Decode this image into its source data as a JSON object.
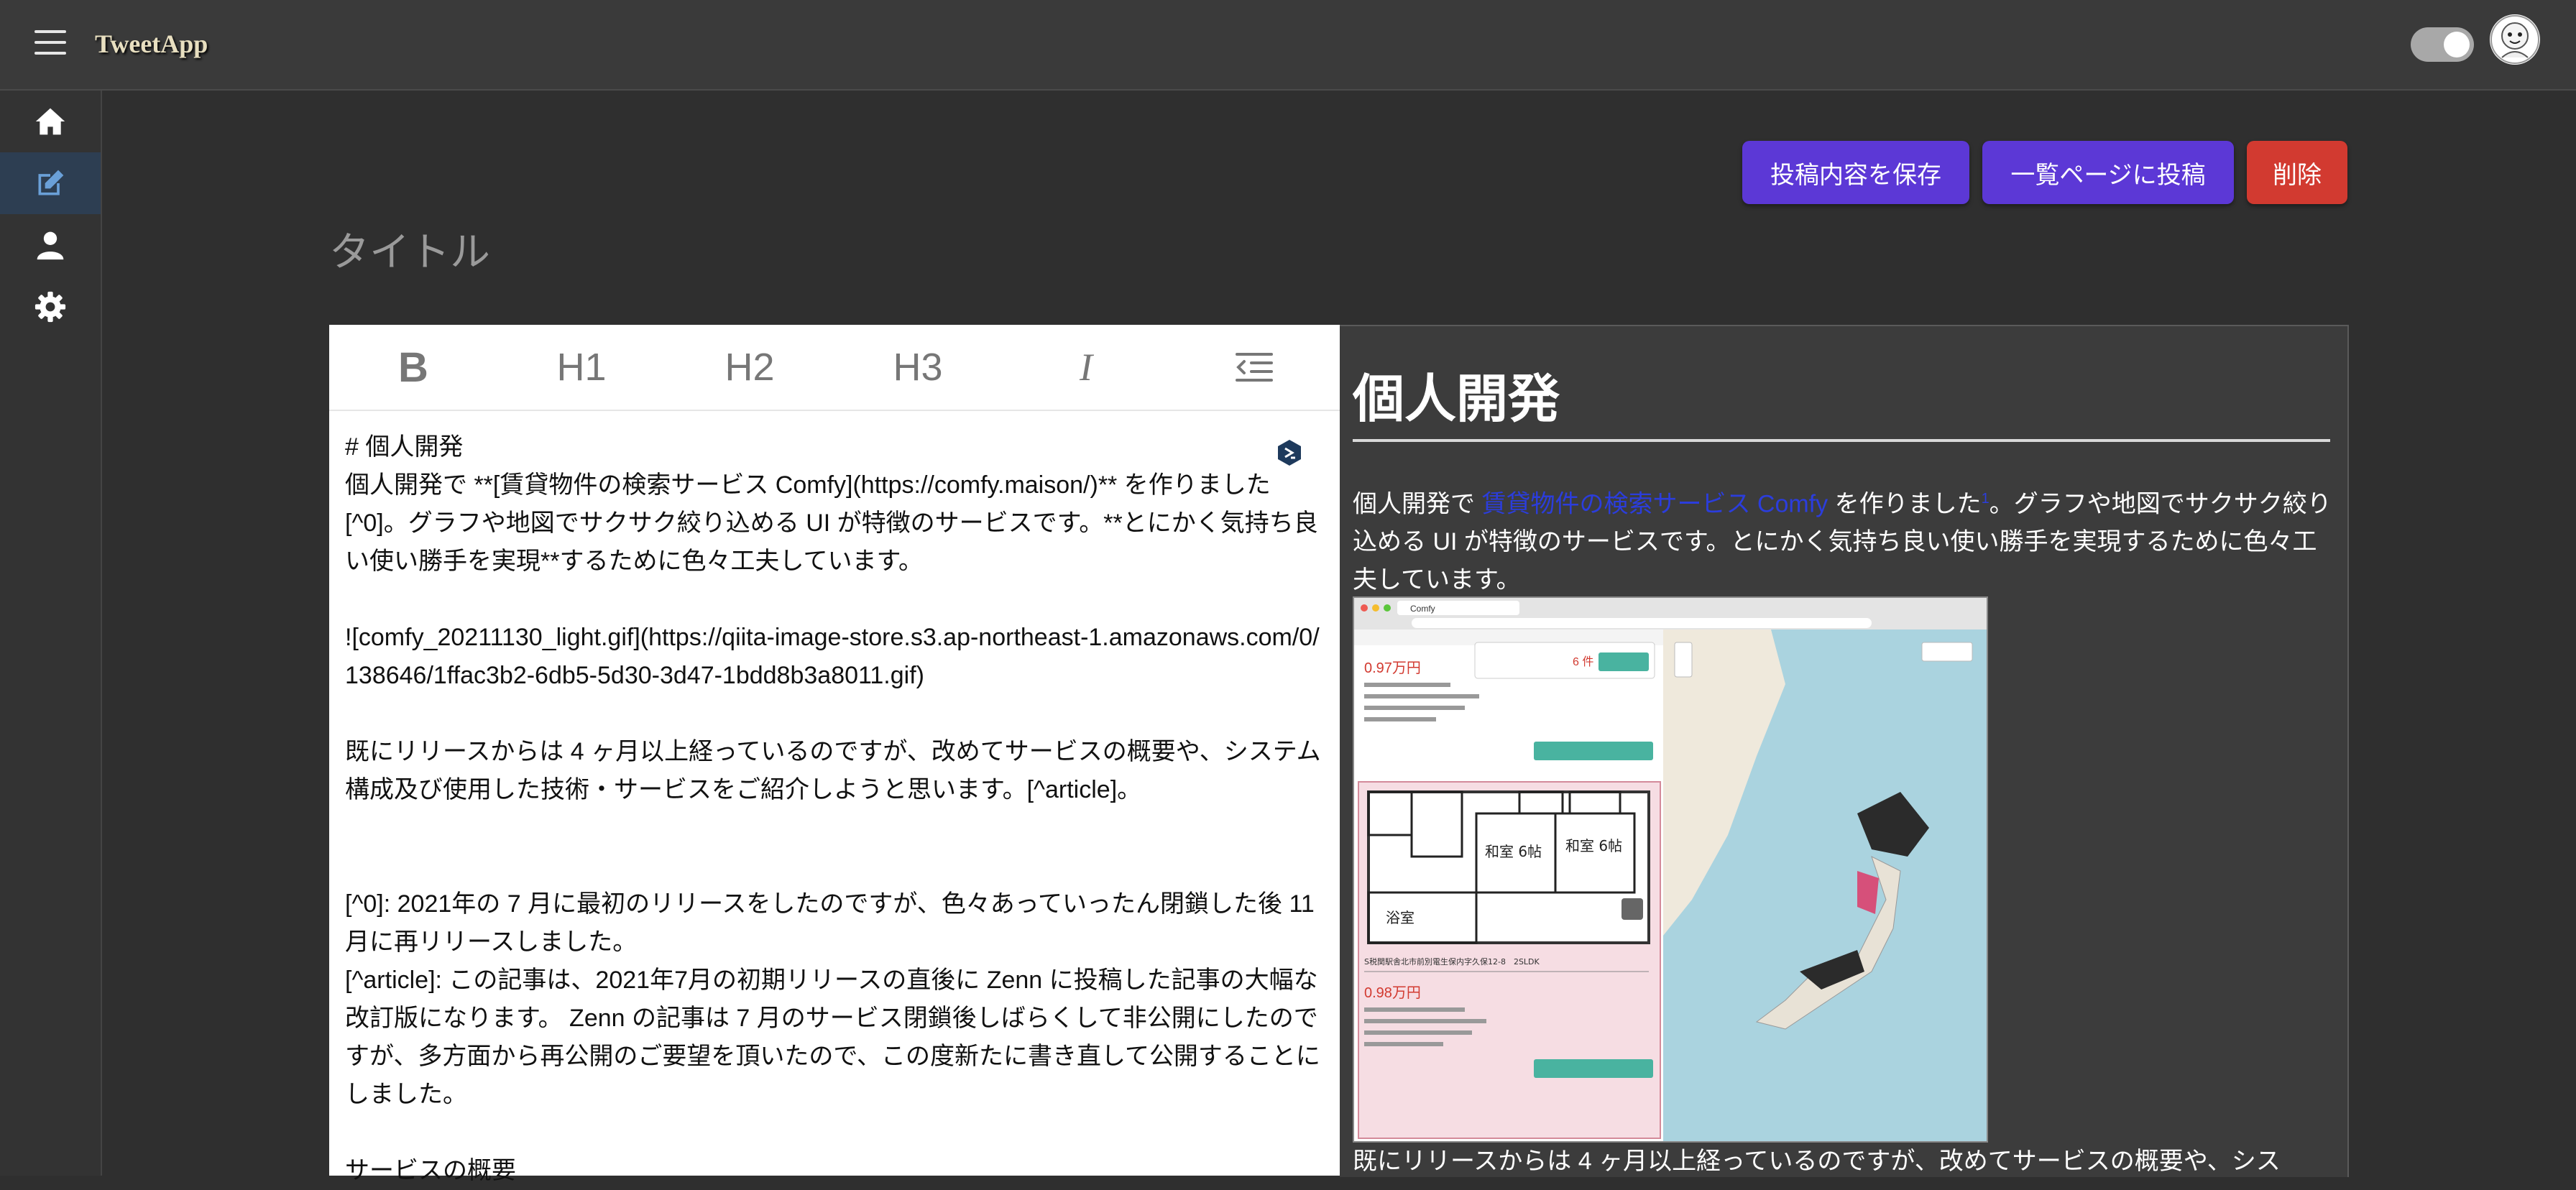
{
  "header": {
    "brand": "TweetApp"
  },
  "sidebar": {
    "items": [
      {
        "icon": "home-icon"
      },
      {
        "icon": "edit-icon",
        "active": true
      },
      {
        "icon": "user-icon"
      },
      {
        "icon": "gear-icon"
      }
    ]
  },
  "actions": {
    "save_label": "投稿内容を保存",
    "post_label": "一覧ページに投稿",
    "delete_label": "削除"
  },
  "title": {
    "placeholder": "タイトル"
  },
  "toolbar": {
    "bold": "B",
    "h1": "H1",
    "h2": "H2",
    "h3": "H3",
    "italic": "I"
  },
  "editor": {
    "line1": "# 個人開発",
    "line2": "個人開発で **[賃貸物件の検索サービス Comfy](https://comfy.maison/)** を作りました[^0]。グラフや地図でサクサク絞り込める UI が特徴のサービスです。**とにかく気持ち良い使い勝手を実現**するために色々工夫しています。",
    "line3": "![comfy_20211130_light.gif](https://qiita-image-store.s3.ap-northeast-1.amazonaws.com/0/138646/1ffac3b2-6db5-5d30-3d47-1bdd8b3a8011.gif)",
    "line4": "既にリリースからは 4 ヶ月以上経っているのですが、改めてサービスの概要や、システム構成及び使用した技術・サービスをご紹介しようと思います。[^article]。",
    "line5": "[^0]: 2021年の 7 月に最初のリリースをしたのですが、色々あっていったん閉鎖した後 11 月に再リリースしました。",
    "line6": "[^article]: この記事は、2021年7月の初期リリースの直後に Zenn に投稿した記事の大幅な改訂版になります。 Zenn の記事は 7 月のサービス閉鎖後しばらくして非公開にしたのですが、多方面から再公開のご要望を頂いたので、この度新たに書き直して公開することにしました。",
    "line7": "サービスの概要"
  },
  "preview": {
    "heading": "個人開発",
    "para_before": "個人開発で ",
    "link": "賃貸物件の検索サービス Comfy",
    "para_mid": " を作りました",
    "footnote": "1",
    "para_after": "。グラフや地図でサクサク絞り込める UI が特徴のサービスです。とにかく気持ち良い使い勝手を実現するために色々工夫しています。",
    "para2": "既にリリースからは 4 ヶ月以上経っているのですが、改めてサービスの概要や、シス",
    "image": {
      "tab_title": "Comfy",
      "price1": "0.97万円",
      "count": "6 件",
      "room1": "和室 6帖",
      "room2": "和室 6帖",
      "bath": "浴室",
      "address": "S税関駅舎北市前別電生保内字久保12-8　2SLDK",
      "price2": "0.98万円"
    }
  },
  "colors": {
    "accent": "#5c38d6",
    "danger": "#d23a30",
    "link": "#2b3ddc"
  }
}
